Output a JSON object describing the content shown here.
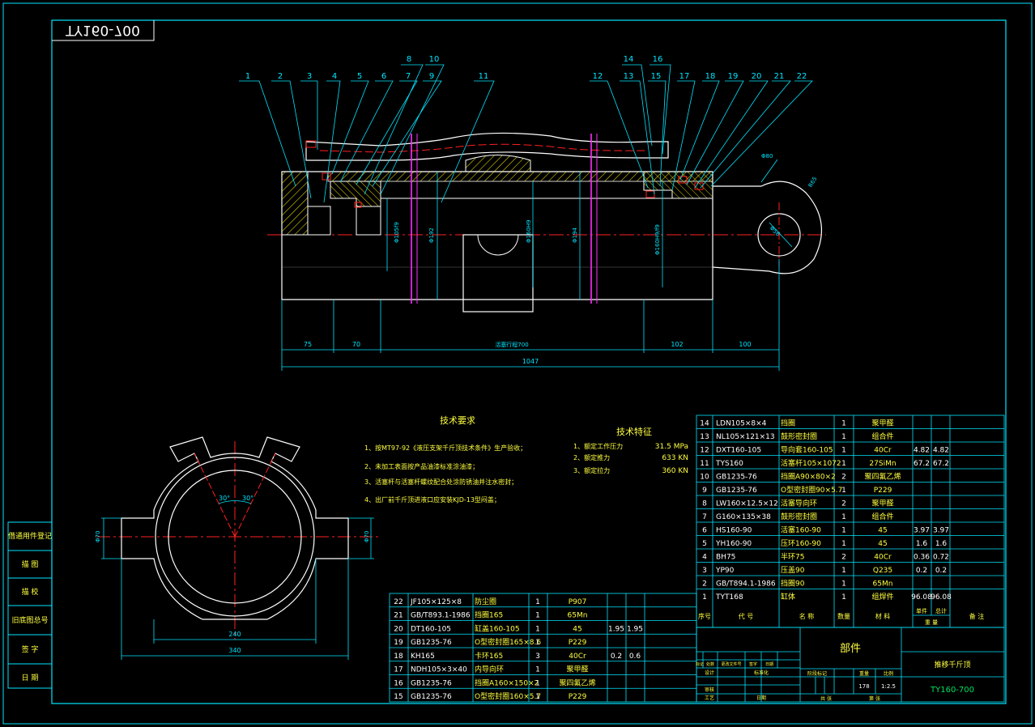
{
  "drawing": {
    "number_mirrored": "TY160-700",
    "background": "#000000",
    "colors": {
      "frame": "#00e5ff",
      "outline": "#ffffff",
      "center": "#ff2020",
      "dim": "#00e5ff",
      "text_cn": "#ffff40",
      "text_en": "#00e060",
      "hatch": "#e0d000",
      "leader": "#00e5ff",
      "magenta": "#ff30ff"
    }
  },
  "balloons": [
    "1",
    "2",
    "3",
    "4",
    "5",
    "6",
    "7",
    "8",
    "9",
    "10",
    "11",
    "12",
    "13",
    "14",
    "15",
    "16",
    "17",
    "18",
    "19",
    "20",
    "21",
    "22"
  ],
  "dims": {
    "overall": "1047",
    "segments": [
      "75",
      "70",
      "活塞行程700",
      "102",
      "100"
    ],
    "diameters": [
      "Φ105f9",
      "Φ192",
      "Φ160H9",
      "Φ194",
      "Φ160H9/f9"
    ],
    "eye": [
      "R65",
      "Φ80",
      "Φ56"
    ],
    "section": [
      "240",
      "340",
      "Φ70",
      "Φ70",
      "30°",
      "30°"
    ]
  },
  "notes": {
    "title": "技术要求",
    "items": [
      "1、按MT97-92《液压支架千斤顶技术条件》生产验收；",
      "2、未加工表面按产品油漆标准涂油漆；",
      "3、活塞杆与活塞杆螺纹配合处涂防锈油并注水密封；",
      "4、出厂前千斤顶进液口应安装KJD-13型闷盖；"
    ]
  },
  "specs": {
    "title": "技术特征",
    "items": [
      {
        "label": "1、额定工作压力",
        "value": "31.5 MPa"
      },
      {
        "label": "2、额定推力",
        "value": "633 KN"
      },
      {
        "label": "3、额定拉力",
        "value": "360 KN"
      }
    ]
  },
  "bom_right": [
    {
      "no": "14",
      "code": "LDN105×8×4",
      "name": "挡圈",
      "qty": "1",
      "mat": "聚甲醛",
      "w1": "",
      "w2": ""
    },
    {
      "no": "13",
      "code": "NL105×121×13",
      "name": "鼓形密封圈",
      "qty": "1",
      "mat": "组合件",
      "w1": "",
      "w2": ""
    },
    {
      "no": "12",
      "code": "DXT160-105",
      "name": "导向套160-105",
      "qty": "1",
      "mat": "40Cr",
      "w1": "4.82",
      "w2": "4.82"
    },
    {
      "no": "11",
      "code": "TYS160",
      "name": "活塞杆105×1072",
      "qty": "1",
      "mat": "27SiMn",
      "w1": "67.2",
      "w2": "67.2"
    },
    {
      "no": "10",
      "code": "GB1235-76",
      "name": "挡圈A90×80×2",
      "qty": "2",
      "mat": "聚四氟乙烯",
      "w1": "",
      "w2": ""
    },
    {
      "no": "9",
      "code": "GB1235-76",
      "name": "O型密封圈90×5.7",
      "qty": "1",
      "mat": "P229",
      "w1": "",
      "w2": ""
    },
    {
      "no": "8",
      "code": "LW160×12.5×12",
      "name": "活塞导向环",
      "qty": "2",
      "mat": "聚甲醛",
      "w1": "",
      "w2": ""
    },
    {
      "no": "7",
      "code": "G160×135×38",
      "name": "鼓形密封圈",
      "qty": "1",
      "mat": "组合件",
      "w1": "",
      "w2": ""
    },
    {
      "no": "6",
      "code": "HS160-90",
      "name": "活塞160-90",
      "qty": "1",
      "mat": "45",
      "w1": "3.97",
      "w2": "3.97"
    },
    {
      "no": "5",
      "code": "YH160-90",
      "name": "压环160-90",
      "qty": "1",
      "mat": "45",
      "w1": "1.6",
      "w2": "1.6"
    },
    {
      "no": "4",
      "code": "BH75",
      "name": "半环75",
      "qty": "2",
      "mat": "40Cr",
      "w1": "0.36",
      "w2": "0.72"
    },
    {
      "no": "3",
      "code": "YP90",
      "name": "压盖90",
      "qty": "1",
      "mat": "Q235",
      "w1": "0.2",
      "w2": "0.2"
    },
    {
      "no": "2",
      "code": "GB/T894.1-1986",
      "name": "挡圈90",
      "qty": "1",
      "mat": "65Mn",
      "w1": "",
      "w2": ""
    },
    {
      "no": "1",
      "code": "TYT168",
      "name": "缸体",
      "qty": "1",
      "mat": "组焊件",
      "w1": "96.08",
      "w2": "96.08"
    }
  ],
  "bom_header": {
    "no": "序号",
    "code": "代  号",
    "name": "名  称",
    "qty": "数量",
    "mat": "材  料",
    "w_single": "单件",
    "w_total": "总计",
    "w_caption": "重  量",
    "remark": "备  注"
  },
  "bom_left": [
    {
      "no": "22",
      "code": "JF105×125×8",
      "name": "防尘圈",
      "qty": "1",
      "mat": "P907",
      "w1": "",
      "w2": ""
    },
    {
      "no": "21",
      "code": "GB/T893.1-1986",
      "name": "挡圈165",
      "qty": "1",
      "mat": "65Mn",
      "w1": "",
      "w2": ""
    },
    {
      "no": "20",
      "code": "DT160-105",
      "name": "缸盖160-105",
      "qty": "1",
      "mat": "45",
      "w1": "1.95",
      "w2": "1.95"
    },
    {
      "no": "19",
      "code": "GB1235-76",
      "name": "O型密封圈165×8.6",
      "qty": "1",
      "mat": "P229",
      "w1": "",
      "w2": ""
    },
    {
      "no": "18",
      "code": "KH165",
      "name": "卡环165",
      "qty": "3",
      "mat": "40Cr",
      "w1": "0.2",
      "w2": "0.6"
    },
    {
      "no": "17",
      "code": "NDH105×3×40",
      "name": "内导向环",
      "qty": "1",
      "mat": "聚甲醛",
      "w1": "",
      "w2": ""
    },
    {
      "no": "16",
      "code": "GB1235-76",
      "name": "挡圈A160×150×2",
      "qty": "1",
      "mat": "聚四氟乙烯",
      "w1": "",
      "w2": ""
    },
    {
      "no": "15",
      "code": "GB1235-76",
      "name": "O型密封圈160×5.7",
      "qty": "1",
      "mat": "P229",
      "w1": "",
      "w2": ""
    }
  ],
  "title_block": {
    "unit": "部件",
    "name": "推移千斤顶",
    "number": "TY160-700",
    "scale_label": "比例",
    "scale": "1:2.5",
    "weight_label": "重量",
    "weight": "178",
    "stage_label": "阶段标记",
    "sheet_label": "共  张",
    "sheet_of": "第  张",
    "rows": [
      "标记",
      "设计",
      "审核",
      "工艺"
    ],
    "cols": [
      "处数",
      "更改文件号",
      "签字",
      "日期"
    ],
    "std": "标准化",
    "approve": "日期"
  },
  "side_strip": [
    "借通用件登记",
    "描  图",
    "描  校",
    "旧底图总号",
    "签  字",
    "日  期"
  ]
}
